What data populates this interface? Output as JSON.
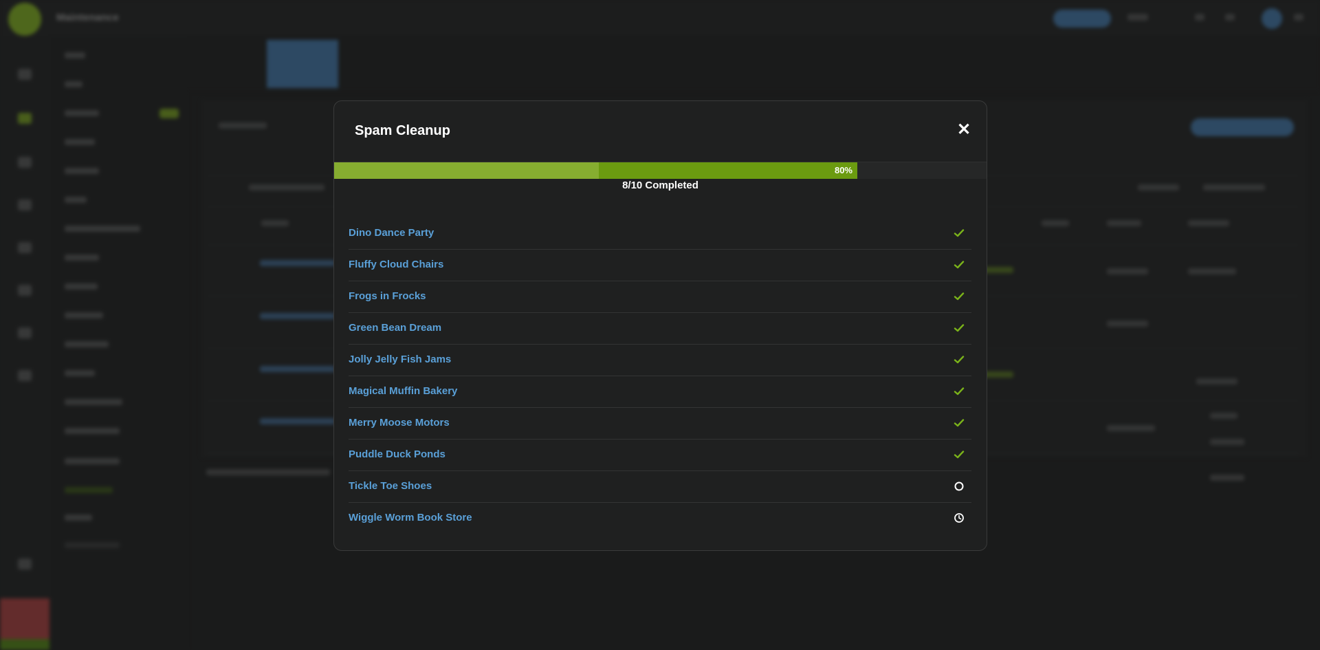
{
  "modal": {
    "title": "Spam Cleanup",
    "close_icon": "close-icon",
    "progress": {
      "percent": 80,
      "percent_label": "80%",
      "completed_label": "8/10 Completed",
      "fill_color": "#6b9b10"
    },
    "items": [
      {
        "name": "Dino Dance Party",
        "status": "done"
      },
      {
        "name": "Fluffy Cloud Chairs",
        "status": "done"
      },
      {
        "name": "Frogs in Frocks",
        "status": "done"
      },
      {
        "name": "Green Bean Dream",
        "status": "done"
      },
      {
        "name": "Jolly Jelly Fish Jams",
        "status": "done"
      },
      {
        "name": "Magical Muffin Bakery",
        "status": "done"
      },
      {
        "name": "Merry Moose Motors",
        "status": "done"
      },
      {
        "name": "Puddle Duck Ponds",
        "status": "done"
      },
      {
        "name": "Tickle Toe Shoes",
        "status": "running"
      },
      {
        "name": "Wiggle Worm Book Store",
        "status": "pending"
      }
    ],
    "status_icons": {
      "done": "check-icon",
      "running": "spinner-icon",
      "pending": "clock-icon"
    }
  },
  "background": {
    "app_title": "Maintenance"
  },
  "colors": {
    "accent_green": "#6b9b10",
    "link_blue": "#5aa0d8",
    "check_green": "#7bb31a"
  }
}
